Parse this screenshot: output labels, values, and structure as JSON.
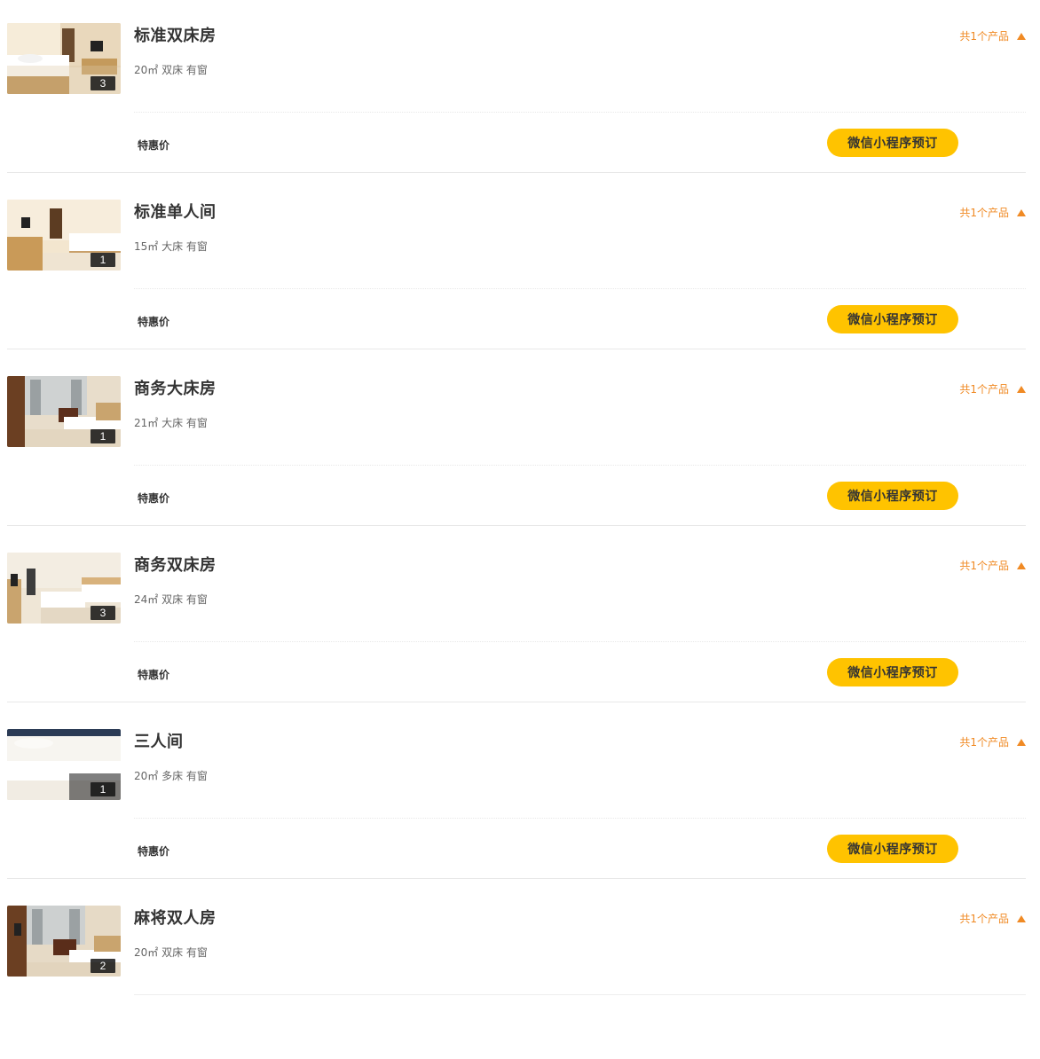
{
  "rooms": [
    {
      "name": "标准双床房",
      "specs": "20㎡ 双床 有窗",
      "photo_count": "3",
      "products_label": "共1个产品",
      "rate_label": "特惠价",
      "book_label": "微信小程序预订",
      "photo_scene": "twin"
    },
    {
      "name": "标准单人间",
      "specs": "15㎡ 大床 有窗",
      "photo_count": "1",
      "products_label": "共1个产品",
      "rate_label": "特惠价",
      "book_label": "微信小程序预订",
      "photo_scene": "single"
    },
    {
      "name": "商务大床房",
      "specs": "21㎡ 大床 有窗",
      "photo_count": "1",
      "products_label": "共1个产品",
      "rate_label": "特惠价",
      "book_label": "微信小程序预订",
      "photo_scene": "business"
    },
    {
      "name": "商务双床房",
      "specs": "24㎡ 双床 有窗",
      "photo_count": "3",
      "products_label": "共1个产品",
      "rate_label": "特惠价",
      "book_label": "微信小程序预订",
      "photo_scene": "business-twin"
    },
    {
      "name": "三人间",
      "specs": "20㎡ 多床 有窗",
      "photo_count": "1",
      "products_label": "共1个产品",
      "rate_label": "特惠价",
      "book_label": "微信小程序预订",
      "photo_scene": "triple"
    },
    {
      "name": "麻将双人房",
      "specs": "20㎡ 双床 有窗",
      "photo_count": "2",
      "products_label": "共1个产品",
      "rate_label": "",
      "book_label": "",
      "photo_scene": "mahjong"
    }
  ],
  "colors": {
    "accent_orange": "#f08a24",
    "book_button": "#ffc300",
    "divider": "#e8e8e8"
  }
}
